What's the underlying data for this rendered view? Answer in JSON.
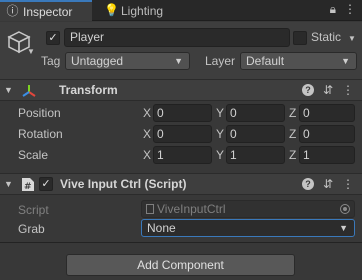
{
  "tabs": {
    "inspector": "Inspector",
    "lighting": "Lighting"
  },
  "game_object": {
    "active": true,
    "name": "Player",
    "static_label": "Static",
    "tag_label": "Tag",
    "tag_value": "Untagged",
    "layer_label": "Layer",
    "layer_value": "Default"
  },
  "transform": {
    "title": "Transform",
    "position": {
      "label": "Position",
      "x": "0",
      "y": "0",
      "z": "0"
    },
    "rotation": {
      "label": "Rotation",
      "x": "0",
      "y": "0",
      "z": "0"
    },
    "scale": {
      "label": "Scale",
      "x": "1",
      "y": "1",
      "z": "1"
    },
    "axis_x": "X",
    "axis_y": "Y",
    "axis_z": "Z"
  },
  "script_component": {
    "enabled": true,
    "title": "Vive Input Ctrl (Script)",
    "script_label": "Script",
    "script_value": "ViveInputCtrl",
    "grab_label": "Grab",
    "grab_value": "None"
  },
  "add_component": "Add Component",
  "colors": {
    "accent": "#3a79bb",
    "background": "#383838",
    "header": "#3e3e3e"
  }
}
